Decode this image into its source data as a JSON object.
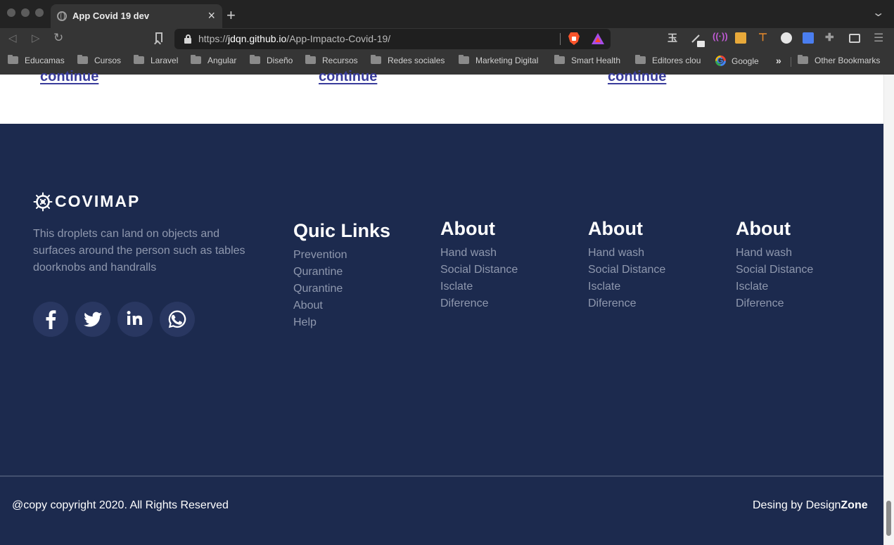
{
  "browser": {
    "tab_title": "App Covid 19 dev",
    "url_scheme": "https://",
    "url_host": "jdqn.github.io",
    "url_path": "/App-Impacto-Covid-19/",
    "bookmarks": [
      {
        "label": "Educamas",
        "icon": "folder-icon"
      },
      {
        "label": "Cursos",
        "icon": "folder-icon"
      },
      {
        "label": "Laravel",
        "icon": "folder-icon"
      },
      {
        "label": "Angular",
        "icon": "folder-icon"
      },
      {
        "label": "Diseño",
        "icon": "folder-icon"
      },
      {
        "label": "Recursos",
        "icon": "folder-icon"
      },
      {
        "label": "Redes sociales",
        "icon": "folder-icon"
      },
      {
        "label": "Marketing Digital",
        "icon": "folder-icon"
      },
      {
        "label": "Smart Health",
        "icon": "folder-icon"
      },
      {
        "label": "Editores clou",
        "icon": "folder-icon"
      },
      {
        "label": "Google",
        "icon": "google-icon"
      }
    ],
    "more_bookmarks": "»",
    "other_bookmarks": "Other Bookmarks"
  },
  "page": {
    "continue_links": [
      "continue",
      "continue",
      "continue"
    ]
  },
  "footer": {
    "brand_name": "COVIMAP",
    "description": "This droplets can land on objects and surfaces around the person such as tables doorknobs and handralls",
    "social": [
      "facebook-icon",
      "twitter-icon",
      "linkedin-icon",
      "whatsapp-icon"
    ],
    "quick_links": {
      "title": "Quic Links",
      "items": [
        "Prevention",
        "Qurantine",
        "Qurantine",
        "About",
        "Help"
      ]
    },
    "about_columns": [
      {
        "title": "About",
        "items": [
          "Hand wash",
          "Social Distance",
          "Isclate",
          "Diference"
        ]
      },
      {
        "title": "About",
        "items": [
          "Hand wash",
          "Social Distance",
          "Isclate",
          "Diference"
        ]
      },
      {
        "title": "About",
        "items": [
          "Hand wash",
          "Social Distance",
          "Isclate",
          "Diference"
        ]
      }
    ],
    "copyright": "@copy copyright 2020. All Rights Reserved",
    "designer_prefix": "Desing by Design",
    "designer_bold": "Zone"
  },
  "colors": {
    "footer_bg": "#1c2a4e",
    "link": "#3a3d9c",
    "muted_text": "#8f98ae"
  }
}
